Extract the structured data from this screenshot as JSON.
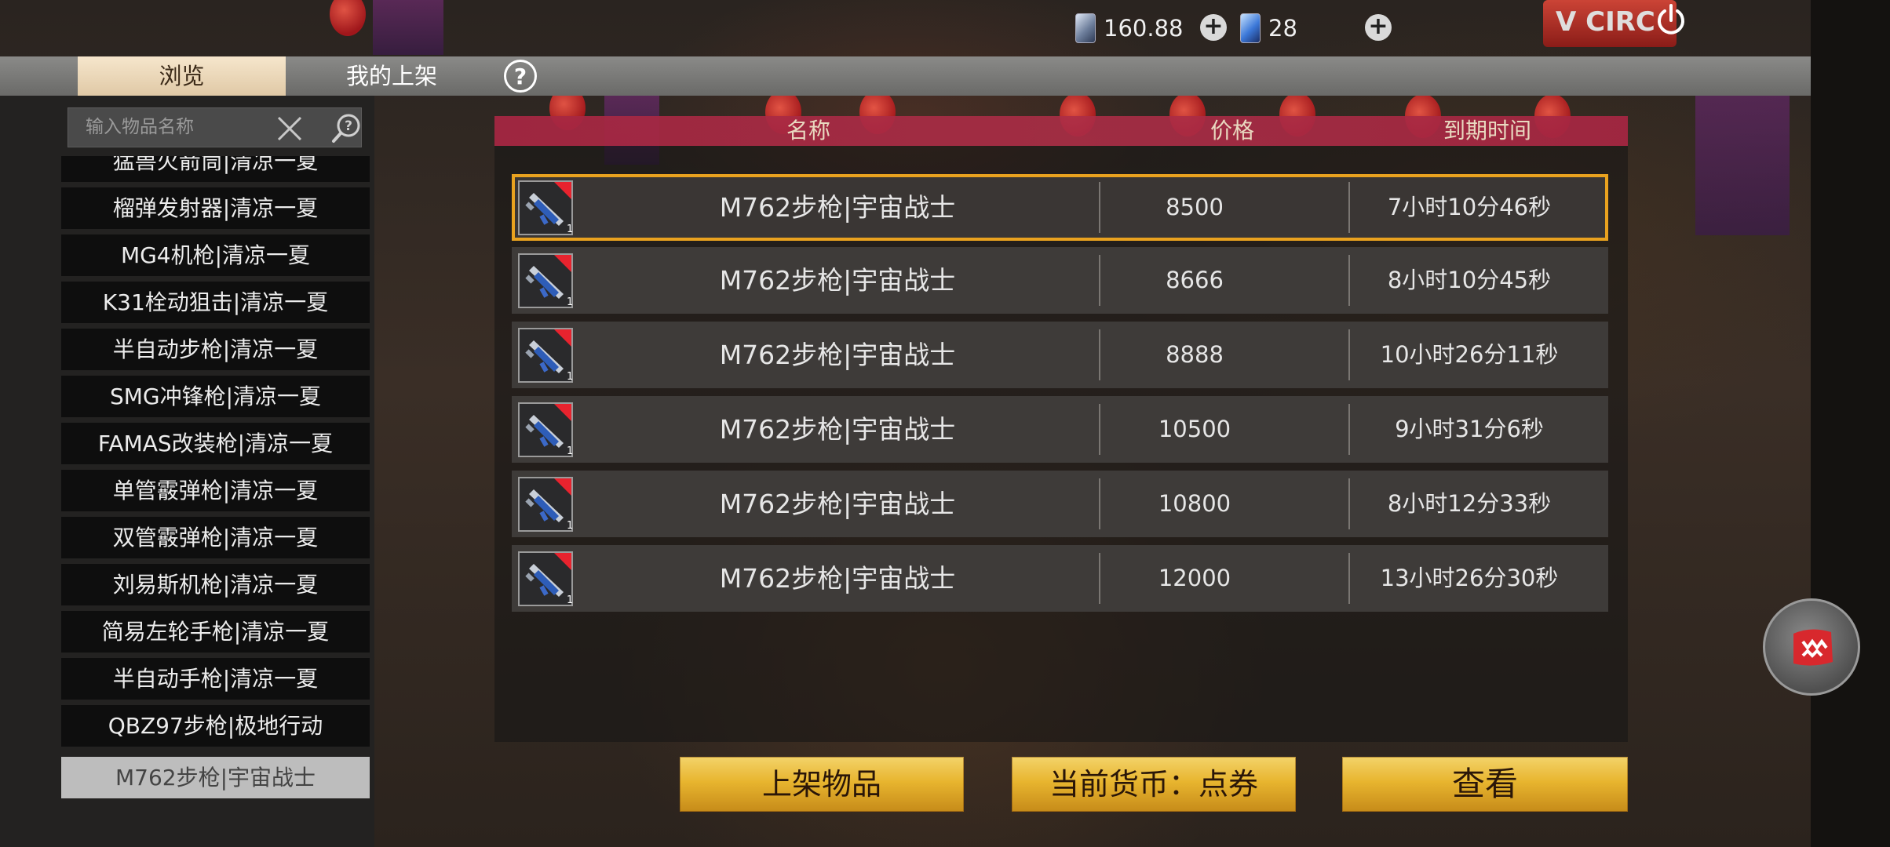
{
  "top_bar": {
    "coupon_value": "160.88",
    "ticket_value": "28",
    "brand_text": "V CIRC"
  },
  "tabs": [
    {
      "label": "浏览",
      "active": true
    },
    {
      "label": "我的上架",
      "active": false
    }
  ],
  "help_label": "?",
  "search": {
    "placeholder": "输入物品名称"
  },
  "item_list": [
    {
      "label": "猛兽火箭筒|清凉一夏"
    },
    {
      "label": "榴弹发射器|清凉一夏"
    },
    {
      "label": "MG4机枪|清凉一夏"
    },
    {
      "label": "K31栓动狙击|清凉一夏"
    },
    {
      "label": "半自动步枪|清凉一夏"
    },
    {
      "label": "SMG冲锋枪|清凉一夏"
    },
    {
      "label": "FAMAS改装枪|清凉一夏"
    },
    {
      "label": "单管霰弹枪|清凉一夏"
    },
    {
      "label": "双管霰弹枪|清凉一夏"
    },
    {
      "label": "刘易斯机枪|清凉一夏"
    },
    {
      "label": "简易左轮手枪|清凉一夏"
    },
    {
      "label": "半自动手枪|清凉一夏"
    },
    {
      "label": "QBZ97步枪|极地行动"
    },
    {
      "label": "M762步枪|宇宙战士",
      "selected": true
    }
  ],
  "table": {
    "headers": {
      "name": "名称",
      "price": "价格",
      "expiry": "到期时间"
    },
    "rows": [
      {
        "name": "M762步枪|宇宙战士",
        "price": "8500",
        "expiry": "7小时10分46秒",
        "selected": true
      },
      {
        "name": "M762步枪|宇宙战士",
        "price": "8666",
        "expiry": "8小时10分45秒"
      },
      {
        "name": "M762步枪|宇宙战士",
        "price": "8888",
        "expiry": "10小时26分11秒"
      },
      {
        "name": "M762步枪|宇宙战士",
        "price": "10500",
        "expiry": "9小时31分6秒"
      },
      {
        "name": "M762步枪|宇宙战士",
        "price": "10800",
        "expiry": "8小时12分33秒"
      },
      {
        "name": "M762步枪|宇宙战士",
        "price": "12000",
        "expiry": "13小时26分30秒"
      }
    ]
  },
  "buttons": {
    "list_item": "上架物品",
    "currency": "当前货币：点券",
    "view": "查看"
  },
  "icons": {
    "coupon": "coupon-card-icon",
    "ticket": "ticket-card-icon",
    "power": "power-icon",
    "clear": "close-icon",
    "search_help": "search-help-icon",
    "item": "rifle-icon"
  },
  "colors": {
    "selected_outline": "#e9a21f",
    "header_band": "#c8325a",
    "gold_button": "#e8b52f"
  }
}
